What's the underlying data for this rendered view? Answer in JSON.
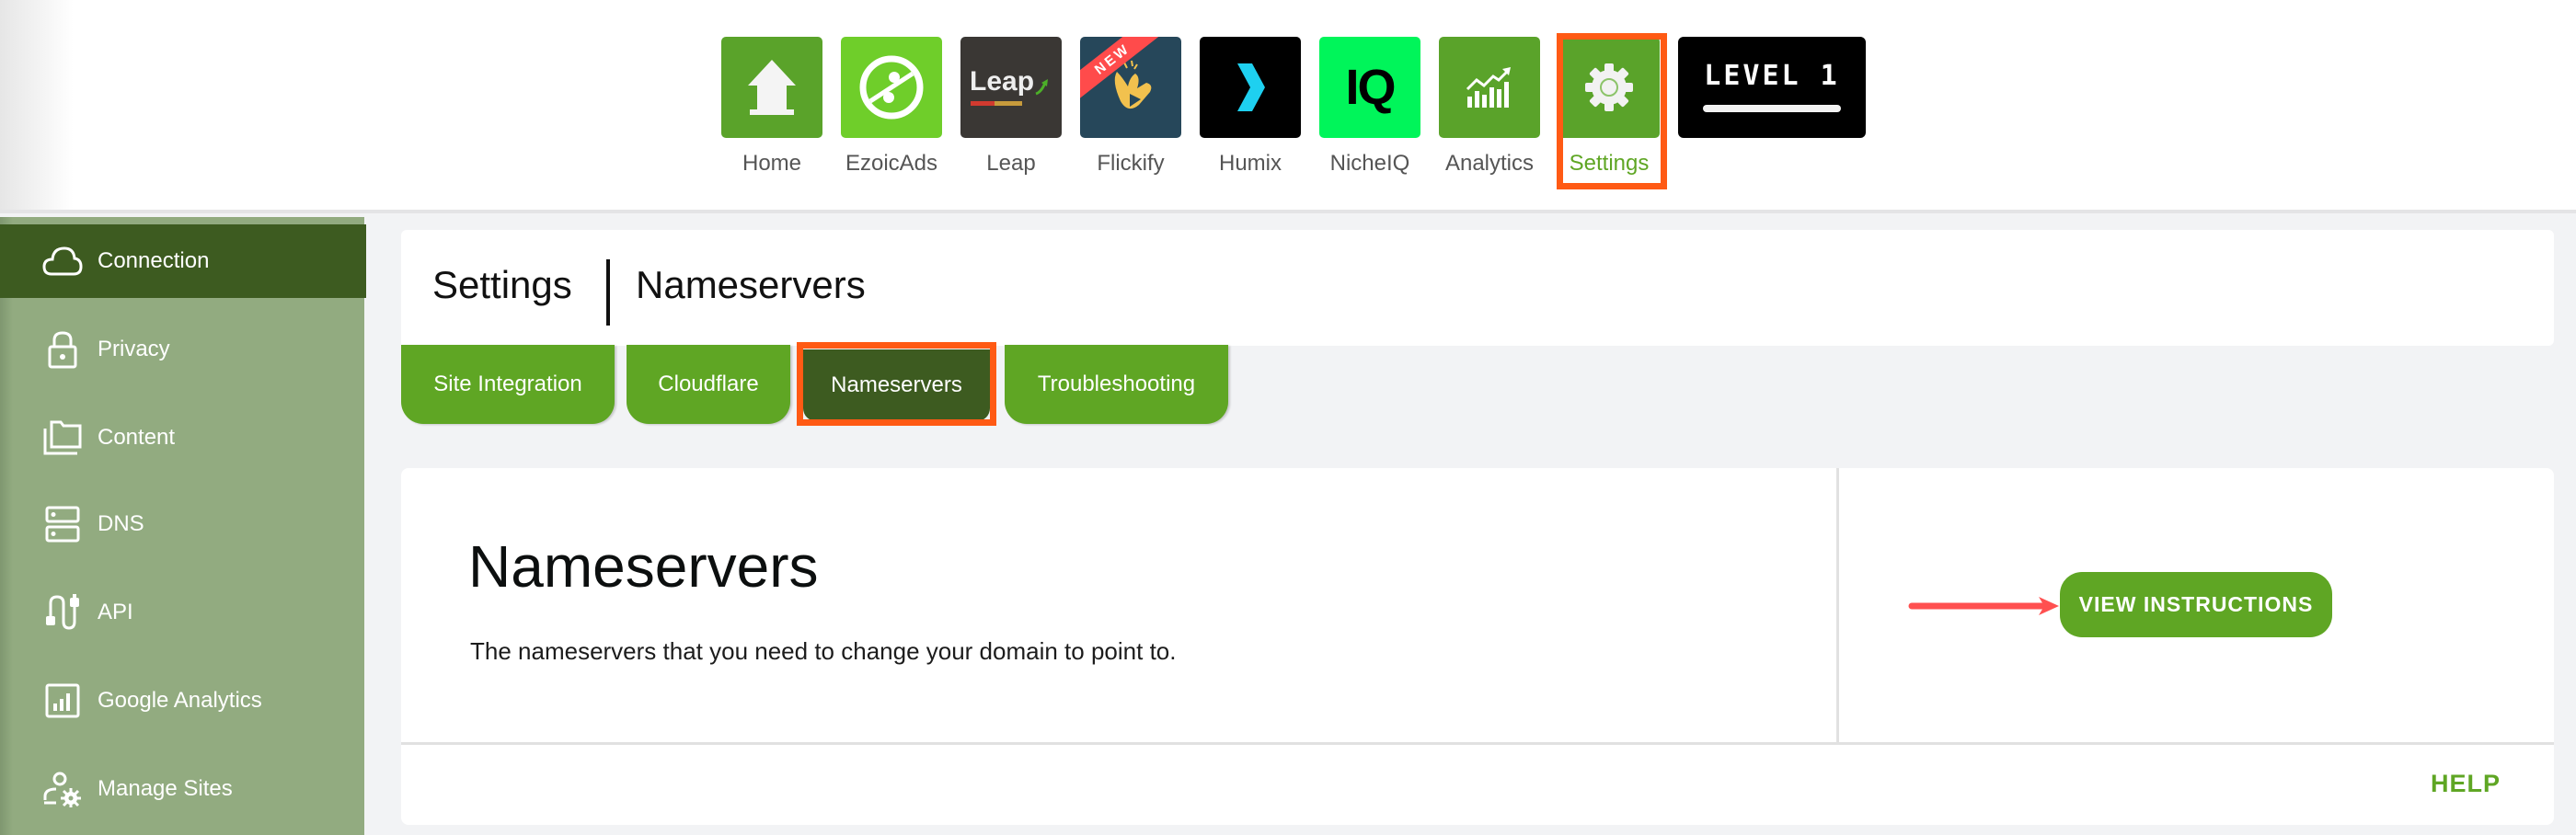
{
  "top_nav": {
    "apps": [
      {
        "label": "Home",
        "icon": "home-icon",
        "color": "#5aa32a"
      },
      {
        "label": "EzoicAds",
        "icon": "ezoicads-icon",
        "color": "#6fce2a"
      },
      {
        "label": "Leap",
        "icon": "leap-logo",
        "logo_text": "Leap",
        "color": "#3a3734"
      },
      {
        "label": "Flickify",
        "icon": "flickify-icon",
        "badge": "NEW",
        "color": "#26475a"
      },
      {
        "label": "Humix",
        "icon": "humix-icon",
        "color": "#000000"
      },
      {
        "label": "NicheIQ",
        "icon": "nicheiq-icon",
        "logo_text": "IQ",
        "color": "#00f55a"
      },
      {
        "label": "Analytics",
        "icon": "analytics-chart-icon",
        "color": "#5aa32a"
      },
      {
        "label": "Settings",
        "icon": "gear-icon",
        "color": "#5aa32a",
        "active": true
      }
    ],
    "level": {
      "label": "LEVEL 1"
    }
  },
  "sidebar": {
    "items": [
      {
        "label": "Connection",
        "icon": "cloud-icon",
        "active": true
      },
      {
        "label": "Privacy",
        "icon": "lock-icon"
      },
      {
        "label": "Content",
        "icon": "folders-icon"
      },
      {
        "label": "DNS",
        "icon": "server-icon"
      },
      {
        "label": "API",
        "icon": "cable-icon"
      },
      {
        "label": "Google Analytics",
        "icon": "bar-chart-icon"
      },
      {
        "label": "Manage Sites",
        "icon": "user-gear-icon"
      }
    ]
  },
  "page_header": {
    "section": "Settings",
    "page": "Nameservers"
  },
  "tabs": [
    {
      "label": "Site Integration"
    },
    {
      "label": "Cloudflare"
    },
    {
      "label": "Nameservers",
      "active": true
    },
    {
      "label": "Troubleshooting"
    }
  ],
  "card": {
    "title": "Nameservers",
    "description": "The nameservers that you need to change your domain to point to.",
    "view_instructions_label": "VIEW INSTRUCTIONS",
    "help_label": "HELP"
  },
  "colors": {
    "brand_green": "#5fa624",
    "dark_green": "#3d5b20",
    "sidebar_green": "#92ab80",
    "highlight_orange": "#ff5a14",
    "arrow_red": "#ff5050"
  }
}
